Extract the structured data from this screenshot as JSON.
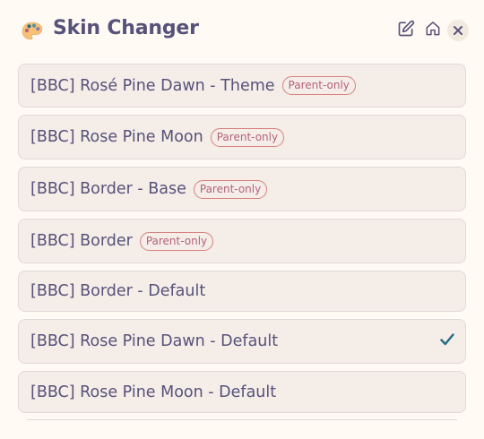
{
  "header": {
    "title": "Skin Changer",
    "logo_icon": "palette-icon",
    "edit_icon": "edit-icon",
    "home_icon": "home-icon",
    "close_icon": "close-icon"
  },
  "skins": [
    {
      "label": "[BBC] Rosé Pine Dawn - Theme",
      "badge": "Parent-only",
      "selected": false
    },
    {
      "label": "[BBC] Rose Pine Moon",
      "badge": "Parent-only",
      "selected": false
    },
    {
      "label": "[BBC] Border - Base",
      "badge": "Parent-only",
      "selected": false
    },
    {
      "label": "[BBC] Border",
      "badge": "Parent-only",
      "selected": false
    },
    {
      "label": "[BBC] Border - Default",
      "badge": null,
      "selected": false
    },
    {
      "label": "[BBC] Rose Pine Dawn - Default",
      "badge": null,
      "selected": true
    },
    {
      "label": "[BBC] Rose Pine Moon - Default",
      "badge": null,
      "selected": false
    }
  ],
  "colors": {
    "background": "#fffaf3",
    "item_background": "#f4ede8",
    "text": "#575279",
    "badge": "#b4637a",
    "check": "#286983"
  }
}
